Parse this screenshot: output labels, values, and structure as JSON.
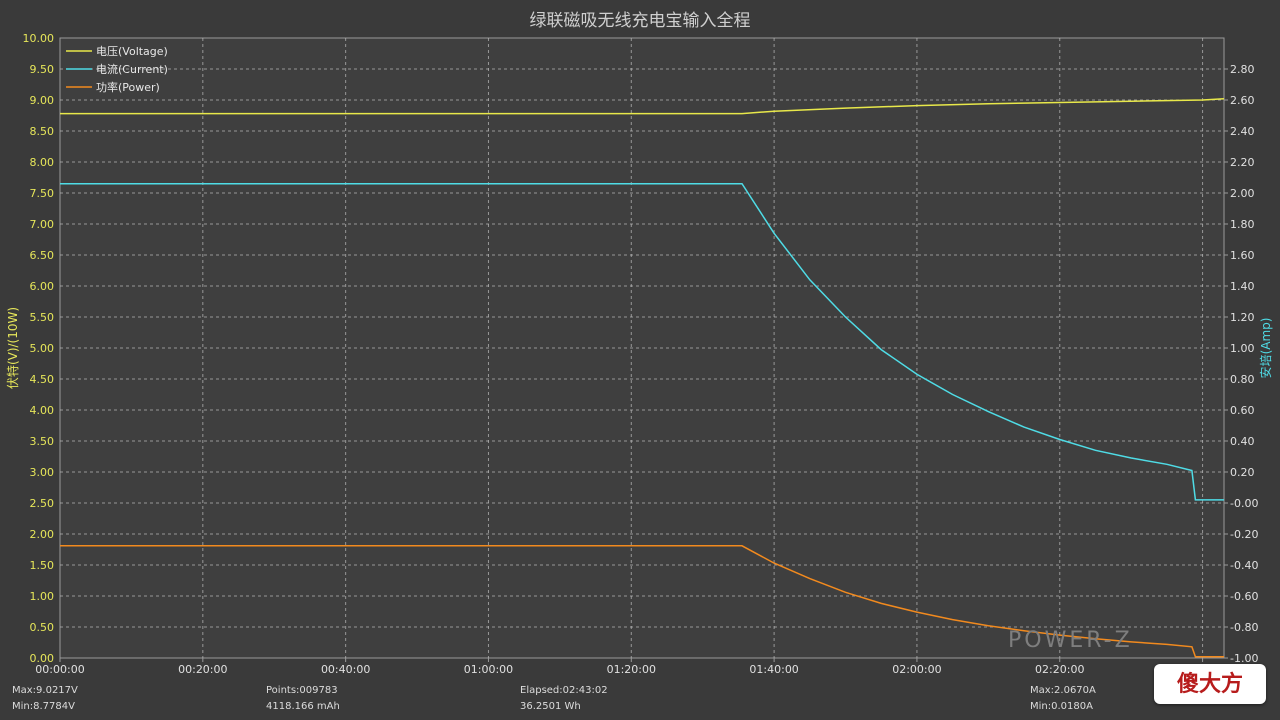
{
  "chart_data": {
    "type": "line",
    "title": "绿联磁吸无线充电宝输入全程",
    "ylabel_left": "伏特(V)/(10W)",
    "ylabel_right": "安培(Amp)",
    "x_ticks": [
      "00:00:00",
      "00:20:00",
      "00:40:00",
      "01:00:00",
      "01:20:00",
      "01:40:00",
      "02:00:00",
      "02:20:00",
      "02:40:00"
    ],
    "x_range_minutes": [
      0,
      163
    ],
    "ylim_left": [
      0,
      10
    ],
    "ylim_right": [
      -1.0,
      3.0
    ],
    "left_ticks": [
      "0.00",
      "0.50",
      "1.00",
      "1.50",
      "2.00",
      "2.50",
      "3.00",
      "3.50",
      "4.00",
      "4.50",
      "5.00",
      "5.50",
      "6.00",
      "6.50",
      "7.00",
      "7.50",
      "8.00",
      "8.50",
      "9.00",
      "9.50",
      "10.00"
    ],
    "right_ticks": [
      "-1.00",
      "-0.80",
      "-0.60",
      "-0.40",
      "-0.20",
      "-0.00",
      "0.20",
      "0.40",
      "0.60",
      "0.80",
      "1.00",
      "1.20",
      "1.40",
      "1.60",
      "1.80",
      "2.00",
      "2.20",
      "2.40",
      "2.60",
      "2.80"
    ],
    "grid": true,
    "legend_position": "top-left",
    "series": [
      {
        "name": "电压(Voltage)",
        "color": "#e8e84a",
        "axis": "left",
        "x": [
          0,
          20,
          40,
          60,
          80,
          95.5,
          100,
          110,
          120,
          130,
          140,
          150,
          160,
          163
        ],
        "y": [
          8.78,
          8.78,
          8.78,
          8.78,
          8.78,
          8.78,
          8.82,
          8.87,
          8.91,
          8.94,
          8.96,
          8.98,
          9.0,
          9.02
        ]
      },
      {
        "name": "电流(Current)",
        "color": "#4fdce6",
        "axis": "right",
        "x": [
          0,
          20,
          40,
          60,
          80,
          95.5,
          100,
          105,
          110,
          115,
          120,
          125,
          130,
          135,
          140,
          145,
          150,
          155,
          158.5,
          159,
          163
        ],
        "y": [
          2.06,
          2.06,
          2.06,
          2.06,
          2.06,
          2.06,
          1.74,
          1.44,
          1.2,
          0.99,
          0.83,
          0.7,
          0.59,
          0.49,
          0.41,
          0.34,
          0.29,
          0.25,
          0.21,
          0.02,
          0.02
        ]
      },
      {
        "name": "功率(Power)",
        "color": "#f28a1e",
        "axis": "left",
        "x": [
          0,
          20,
          40,
          60,
          80,
          95.5,
          100,
          105,
          110,
          115,
          120,
          125,
          130,
          135,
          140,
          145,
          150,
          155,
          158.5,
          159,
          163
        ],
        "y": [
          1.81,
          1.81,
          1.81,
          1.81,
          1.81,
          1.81,
          1.53,
          1.28,
          1.06,
          0.88,
          0.74,
          0.62,
          0.52,
          0.44,
          0.37,
          0.31,
          0.26,
          0.22,
          0.18,
          0.02,
          0.02
        ]
      }
    ]
  },
  "stats": {
    "max_voltage": "Max:9.0217V",
    "min_voltage": "Min:8.7784V",
    "points": "Points:009783",
    "mah": "4118.166 mAh",
    "elapsed": "Elapsed:02:43:02",
    "wh": "36.2501 Wh",
    "max_current": "Max:2.0670A",
    "min_current": "Min:0.0180A"
  },
  "brand_text": "POWER-Z",
  "watermark_text": "傻大方"
}
